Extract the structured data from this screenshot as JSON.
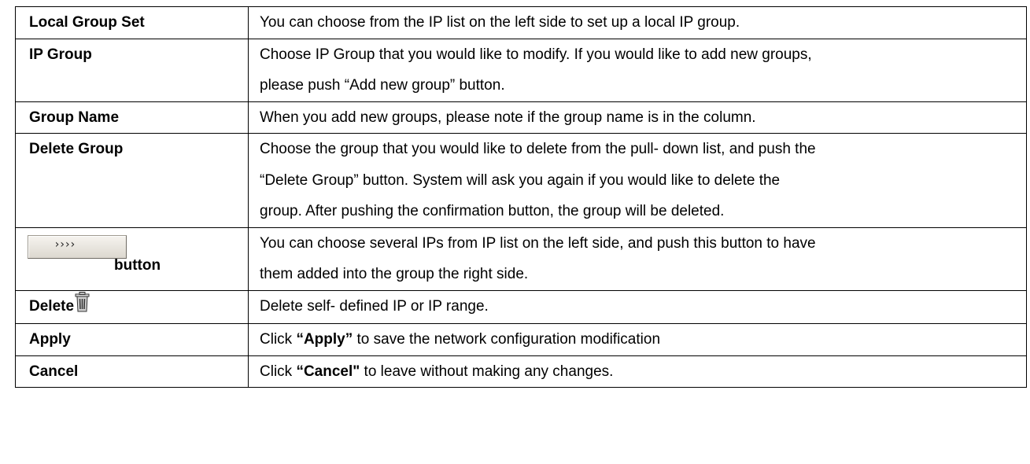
{
  "rows": [
    {
      "term": "Local Group Set",
      "lines": [
        "You can choose from the IP list on the left side to set up a local IP group."
      ]
    },
    {
      "term": "IP Group",
      "lines": [
        "Choose IP Group that you would like to modify. If you would like to add new groups,",
        "please push “Add new group” button."
      ]
    },
    {
      "term": "Group Name",
      "lines": [
        "When you add new groups, please note if the group name is in the column."
      ]
    },
    {
      "term": "Delete Group",
      "lines": [
        "Choose the group that you would like to delete from the pull- down list, and push the",
        "“Delete Group” button. System will ask you again if you would like to delete the",
        "group. After pushing the confirmation button, the group will be deleted."
      ]
    },
    {
      "term_button_label": "››››",
      "term_suffix": "button",
      "lines": [
        "You can choose several IPs from IP list on the left side, and push this button to have",
        "them added into the group the right side."
      ]
    },
    {
      "term": "Delete",
      "term_icon": "trash-icon",
      "lines": [
        "Delete self- defined IP or IP range."
      ]
    },
    {
      "term": "Apply",
      "desc_prefix": "Click ",
      "desc_bold": "“Apply”",
      "desc_suffix": " to save the network configuration modification"
    },
    {
      "term": "Cancel",
      "desc_prefix": "Click ",
      "desc_bold": "“Cancel\"",
      "desc_suffix": " to leave without making any changes."
    }
  ]
}
